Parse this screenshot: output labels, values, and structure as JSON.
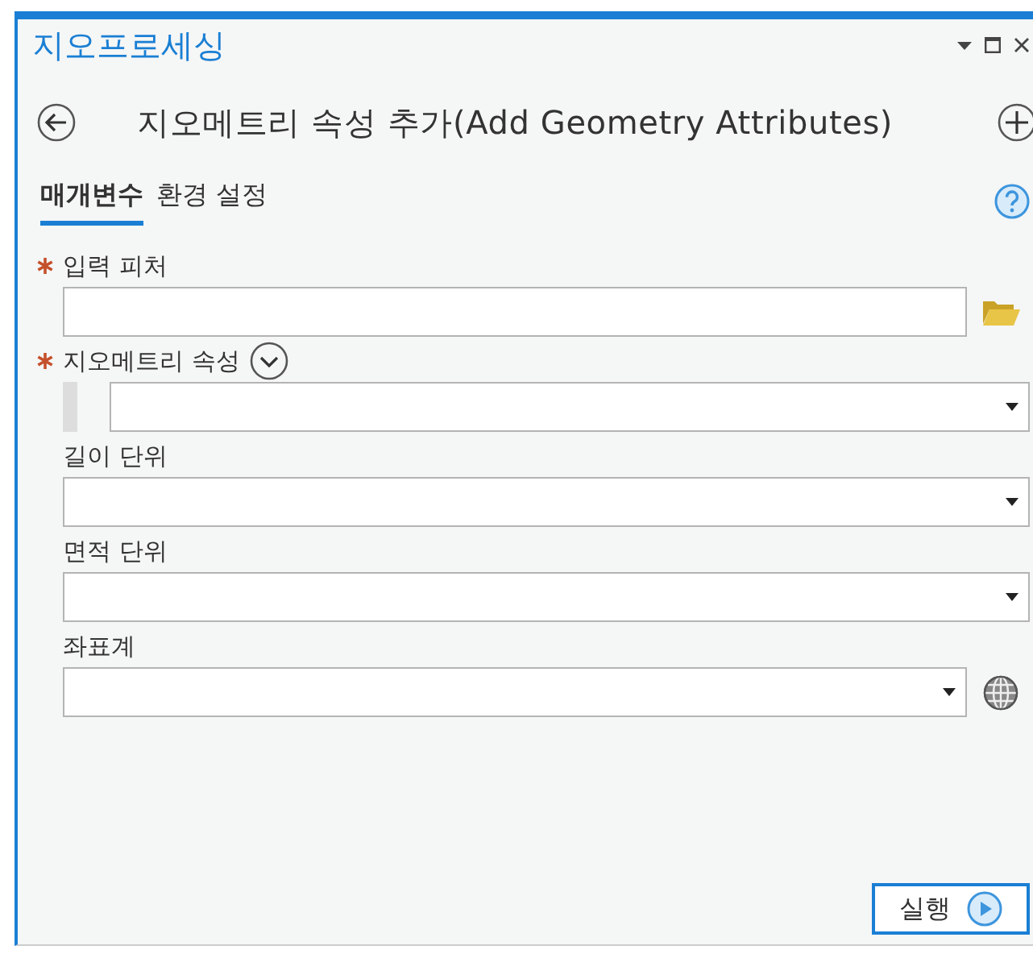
{
  "panel": {
    "title": "지오프로세싱"
  },
  "tool": {
    "title": "지오메트리 속성 추가(Add Geometry Attributes)"
  },
  "tabs": [
    {
      "label": "매개변수",
      "selected": true
    },
    {
      "label": "환경 설정",
      "selected": false
    }
  ],
  "parameters": [
    {
      "kind": "file",
      "label": "입력 피처",
      "required": true
    },
    {
      "kind": "multi",
      "label": "지오메트리 속성",
      "required": true
    },
    {
      "kind": "dropdown",
      "label": "길이 단위",
      "required": false
    },
    {
      "kind": "dropdown",
      "label": "면적 단위",
      "required": false
    },
    {
      "kind": "coordinate",
      "label": "좌표계",
      "required": false
    }
  ],
  "run_button": {
    "label": "실행"
  }
}
